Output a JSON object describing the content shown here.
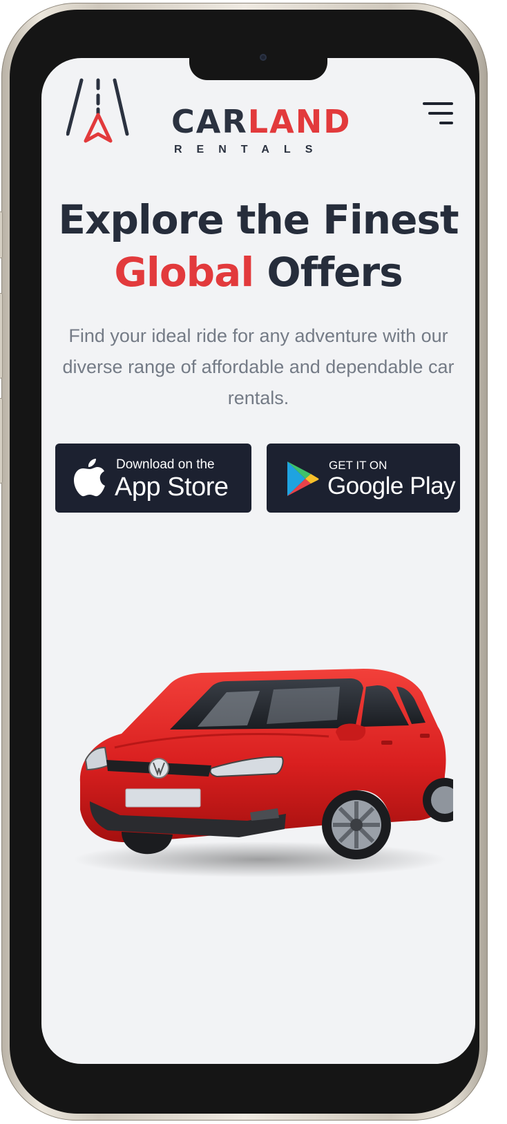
{
  "brand": {
    "name_part1": "CAR",
    "name_part2": "LAND",
    "subtitle": "RENTALS",
    "accent_color": "#e23a3c",
    "dark_color": "#2b3240"
  },
  "menu": {
    "icon": "hamburger-menu-icon"
  },
  "hero": {
    "title_line1": "Explore the Finest",
    "title_highlight": "Global",
    "title_line2_rest": "Offers",
    "description": "Find your ideal ride for any adventure with our diverse range of affordable and dependable car rentals."
  },
  "store_buttons": {
    "apple": {
      "small_label": "Download on the",
      "big_label": "App Store",
      "icon": "apple-icon"
    },
    "google": {
      "small_label": "GET IT ON",
      "big_label": "Google Play",
      "icon": "google-play-icon"
    }
  },
  "hero_image": {
    "icon": "red-hatchback-car-image"
  }
}
